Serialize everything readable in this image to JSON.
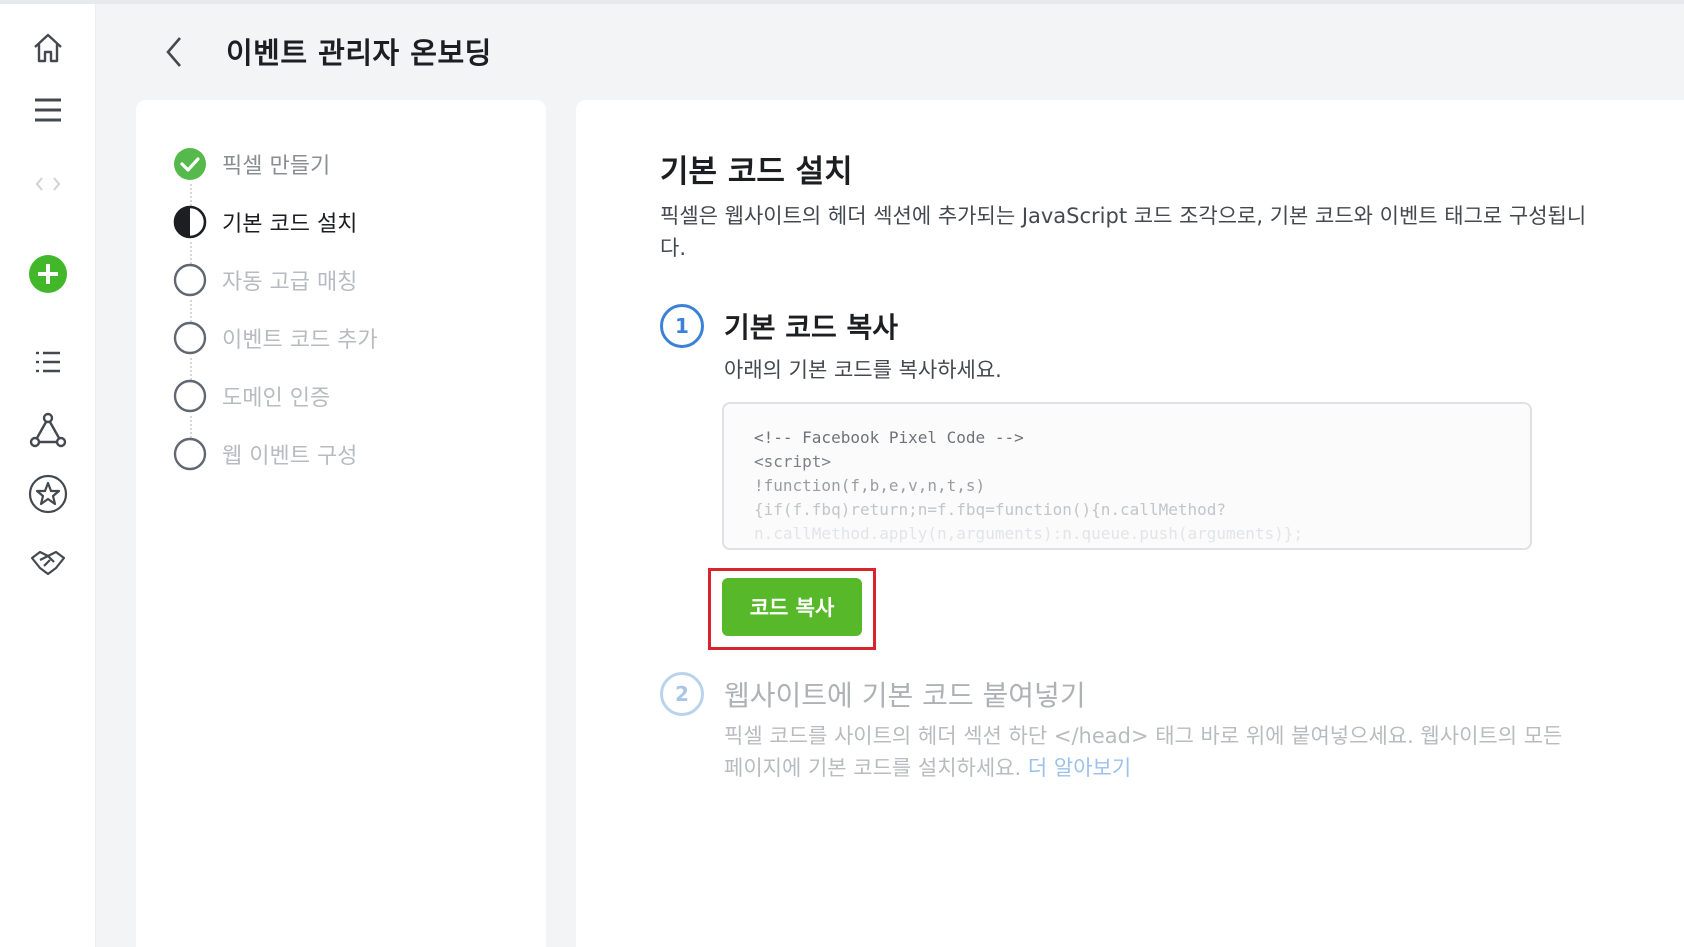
{
  "header": {
    "title": "이벤트 관리자 온보딩"
  },
  "rail": {
    "icons": [
      "home-icon",
      "menu-icon",
      "placeholder-icon",
      "add-icon",
      "list-icon",
      "network-icon",
      "star-icon",
      "handshake-icon"
    ],
    "add_color": "#42b72a"
  },
  "steps": [
    {
      "label": "픽셀 만들기",
      "state": "done"
    },
    {
      "label": "기본 코드 설치",
      "state": "current"
    },
    {
      "label": "자동 고급 매칭",
      "state": "todo"
    },
    {
      "label": "이벤트 코드 추가",
      "state": "todo"
    },
    {
      "label": "도메인 인증",
      "state": "todo"
    },
    {
      "label": "웹 이벤트 구성",
      "state": "todo"
    }
  ],
  "content": {
    "title": "기본 코드 설치",
    "description": "픽셀은 웹사이트의 헤더 섹션에 추가되는 JavaScript 코드 조각으로, 기본 코드와 이벤트 태그로 구성됩니다.",
    "step1": {
      "number": "1",
      "title": "기본 코드 복사",
      "description": "아래의 기본 코드를 복사하세요.",
      "code_lines": [
        "<!-- Facebook Pixel Code -->",
        "<script>",
        "!function(f,b,e,v,n,t,s)",
        "{if(f.fbq)return;n=f.fbq=function(){n.callMethod?",
        "n.callMethod.apply(n,arguments):n.queue.push(arguments)};"
      ],
      "copy_button": "코드 복사"
    },
    "step2": {
      "number": "2",
      "title": "웹사이트에 기본 코드 붙여넣기",
      "description": "픽셀 코드를 사이트의 헤더 섹션 하단 </head> 태그 바로 위에 붙여넣으세요. 웹사이트의 모든 페이지에 기본 코드를 설치하세요.",
      "learn_more": "더 알아보기"
    }
  },
  "colors": {
    "accent_green": "#57b82a",
    "step_done": "#55b94b",
    "step_number_active": "#3b82d6",
    "highlight_red": "#d9232e"
  }
}
